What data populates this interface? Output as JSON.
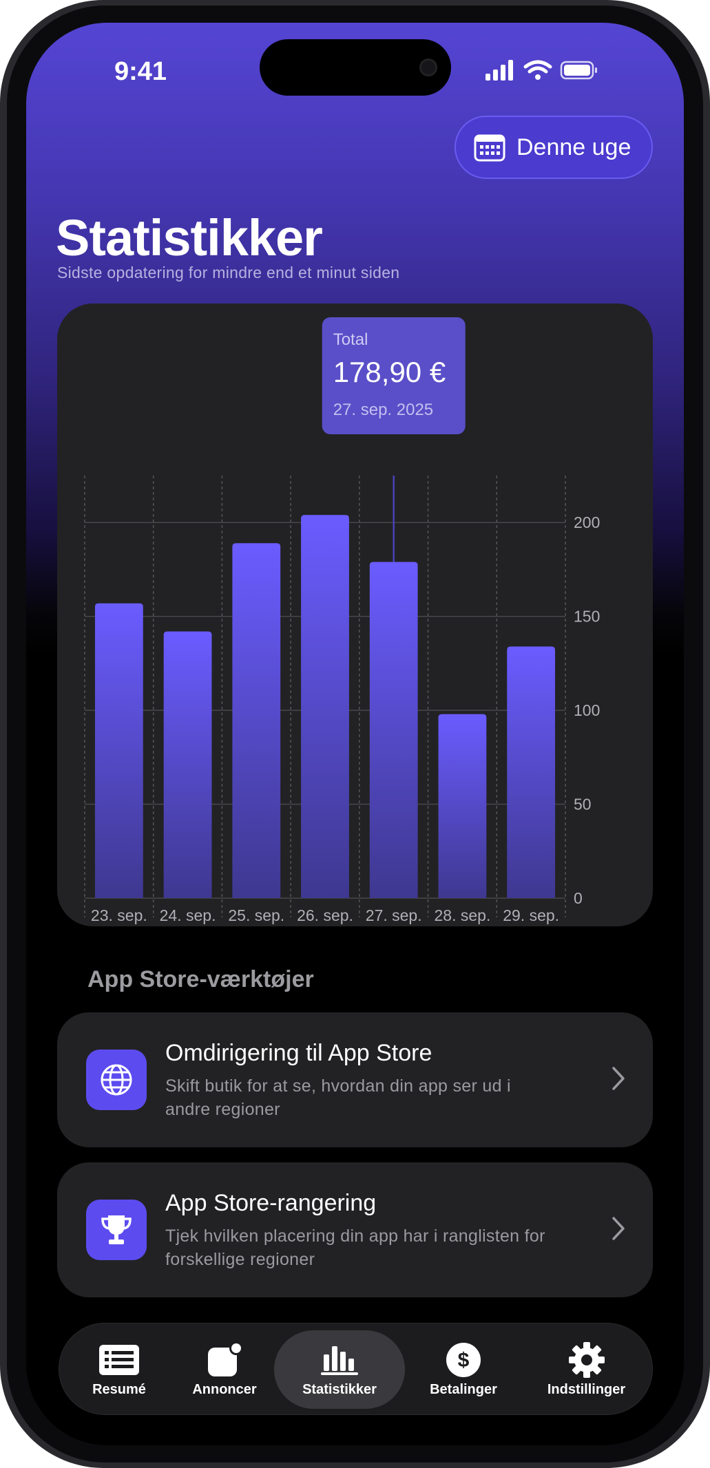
{
  "status_bar": {
    "time": "9:41"
  },
  "header": {
    "period_button_label": "Denne uge",
    "title": "Statistikker",
    "subtitle": "Sidste opdatering for mindre end et minut siden"
  },
  "tooltip": {
    "label": "Total",
    "value": "178,90 €",
    "date": "27. sep. 2025"
  },
  "chart_data": {
    "type": "bar",
    "categories": [
      "23. sep.",
      "24. sep.",
      "25. sep.",
      "26. sep.",
      "27. sep.",
      "28. sep.",
      "29. sep."
    ],
    "values": [
      157,
      142,
      189,
      204,
      179,
      98,
      134
    ],
    "ylim": [
      0,
      225
    ],
    "yticks": [
      0,
      50,
      100,
      150,
      200
    ],
    "selected_index": 4,
    "bar_color": "#6a5cff",
    "grid": true,
    "y_axis_position": "right"
  },
  "tools": {
    "section_title": "App Store-værktøjer",
    "items": [
      {
        "icon": "globe-icon",
        "title": "Omdirigering til App Store",
        "description": "Skift butik for at se, hvordan din app ser ud i andre regioner"
      },
      {
        "icon": "trophy-icon",
        "title": "App Store-rangering",
        "description": "Tjek hvilken placering din app har i ranglisten for forskellige regioner"
      }
    ]
  },
  "tabbar": {
    "items": [
      {
        "label": "Resumé",
        "icon": "list-icon"
      },
      {
        "label": "Annoncer",
        "icon": "ad-notification-icon"
      },
      {
        "label": "Statistikker",
        "icon": "bar-chart-icon",
        "active": true
      },
      {
        "label": "Betalinger",
        "icon": "dollar-icon"
      },
      {
        "label": "Indstillinger",
        "icon": "gear-icon"
      }
    ]
  },
  "colors": {
    "accent": "#5c4cf0",
    "header_gradient_top": "#5545d4",
    "card_background": "#222224"
  }
}
